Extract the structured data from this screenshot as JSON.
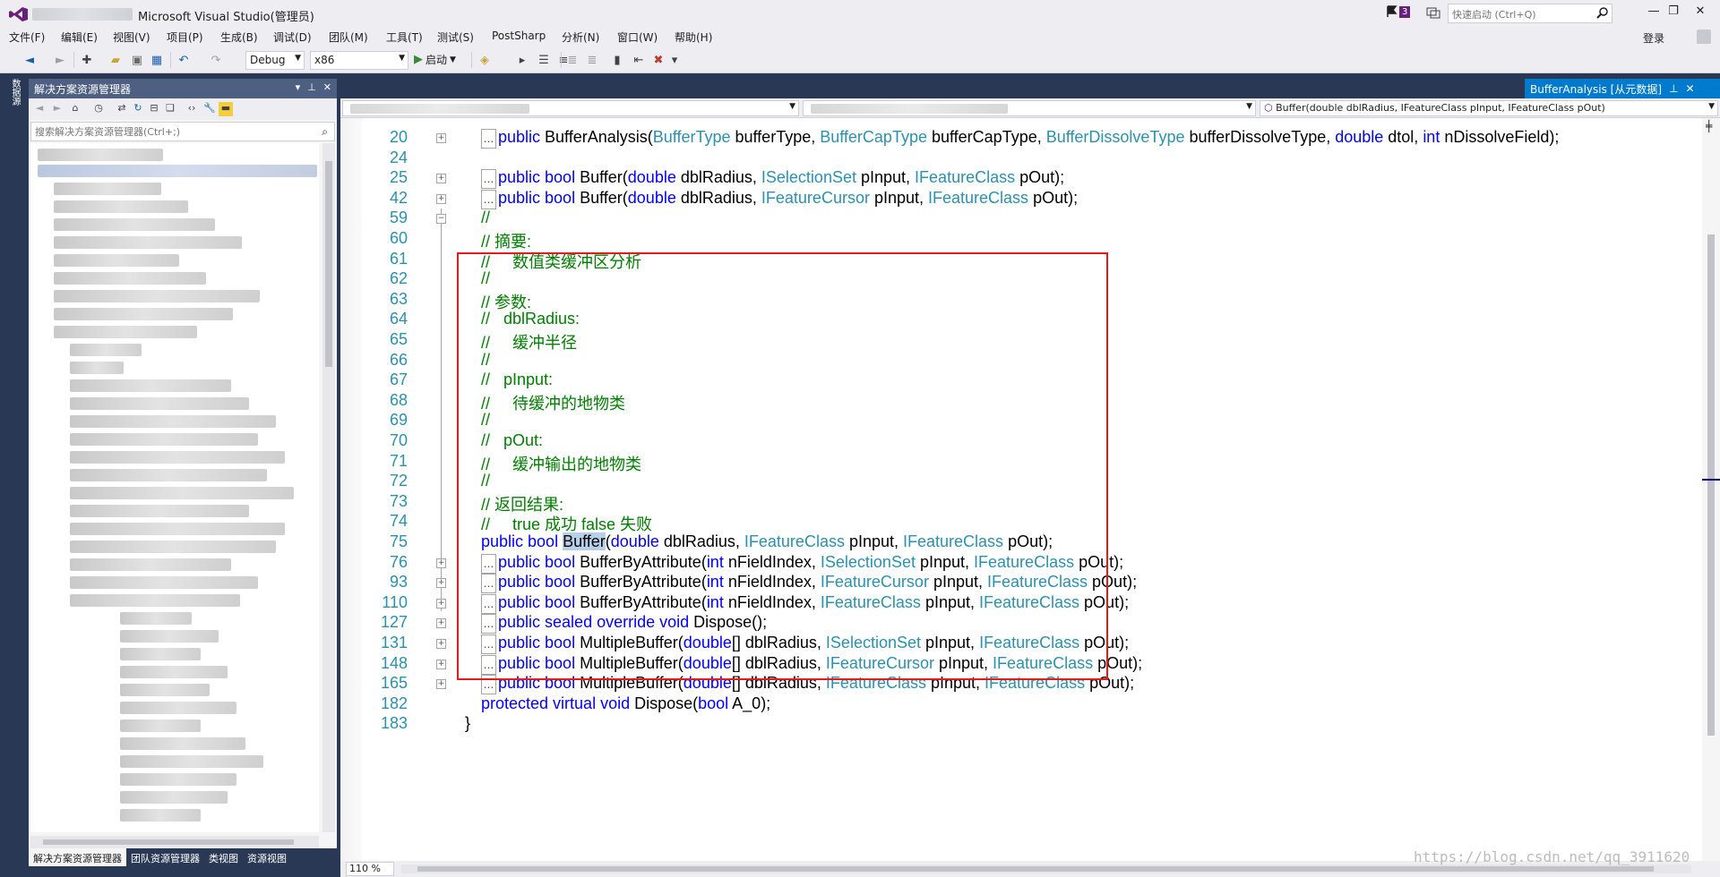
{
  "window": {
    "title": "Microsoft Visual Studio(管理员)",
    "notification_count": "3",
    "quick_launch_placeholder": "快速启动 (Ctrl+Q)"
  },
  "menu": {
    "items": [
      "文件(F)",
      "编辑(E)",
      "视图(V)",
      "项目(P)",
      "生成(B)",
      "调试(D)",
      "团队(M)",
      "工具(T)",
      "测试(S)",
      "PostSharp",
      "分析(N)",
      "窗口(W)",
      "帮助(H)"
    ],
    "login": "登录"
  },
  "toolbar": {
    "configuration": "Debug",
    "platform": "x86",
    "start_label": "启动"
  },
  "left_strip": {
    "tab_label": "数据源"
  },
  "solution_explorer": {
    "title": "解决方案资源管理器",
    "search_placeholder": "搜索解决方案资源管理器(Ctrl+;)",
    "bottom_tabs": [
      "解决方案资源管理器",
      "团队资源管理器",
      "类视图",
      "资源视图"
    ]
  },
  "editor": {
    "tab_title": "BufferAnalysis [从元数据]",
    "nav_member": "Buffer(double dblRadius, IFeatureClass pInput, IFeatureClass pOut)",
    "zoom": "110 %",
    "watermark": "https://blog.csdn.net/qq_3911620",
    "lines": [
      {
        "n": "20",
        "fold": "+",
        "collapsed": true,
        "segs": [
          [
            "kw",
            "public "
          ],
          [
            "",
            "BufferAnalysis("
          ],
          [
            "ty",
            "BufferType"
          ],
          [
            "",
            " bufferType, "
          ],
          [
            "ty",
            "BufferCapType"
          ],
          [
            "",
            " bufferCapType, "
          ],
          [
            "ty",
            "BufferDissolveType"
          ],
          [
            "",
            " bufferDissolveType, "
          ],
          [
            "kw",
            "double"
          ],
          [
            "",
            " dtol, "
          ],
          [
            "kw",
            "int"
          ],
          [
            "",
            " nDissolveField);"
          ]
        ]
      },
      {
        "n": "24",
        "fold": "",
        "collapsed": false,
        "segs": []
      },
      {
        "n": "25",
        "fold": "+",
        "collapsed": true,
        "segs": [
          [
            "kw",
            "public bool "
          ],
          [
            "",
            "Buffer("
          ],
          [
            "kw",
            "double"
          ],
          [
            "",
            " dblRadius, "
          ],
          [
            "ty",
            "ISelectionSet"
          ],
          [
            "",
            " pInput, "
          ],
          [
            "ty",
            "IFeatureClass"
          ],
          [
            "",
            " pOut);"
          ]
        ]
      },
      {
        "n": "42",
        "fold": "+",
        "collapsed": true,
        "segs": [
          [
            "kw",
            "public bool "
          ],
          [
            "",
            "Buffer("
          ],
          [
            "kw",
            "double"
          ],
          [
            "",
            " dblRadius, "
          ],
          [
            "ty",
            "IFeatureCursor"
          ],
          [
            "",
            " pInput, "
          ],
          [
            "ty",
            "IFeatureClass"
          ],
          [
            "",
            " pOut);"
          ]
        ]
      },
      {
        "n": "59",
        "fold": "−",
        "collapsed": false,
        "segs": [
          [
            "cm",
            "//"
          ]
        ]
      },
      {
        "n": "60",
        "fold": "",
        "collapsed": false,
        "segs": [
          [
            "cm",
            "// 摘要:"
          ]
        ]
      },
      {
        "n": "61",
        "fold": "",
        "collapsed": false,
        "segs": [
          [
            "cm",
            "//     数值类缓冲区分析"
          ]
        ]
      },
      {
        "n": "62",
        "fold": "",
        "collapsed": false,
        "segs": [
          [
            "cm",
            "//"
          ]
        ]
      },
      {
        "n": "63",
        "fold": "",
        "collapsed": false,
        "segs": [
          [
            "cm",
            "// 参数:"
          ]
        ]
      },
      {
        "n": "64",
        "fold": "",
        "collapsed": false,
        "segs": [
          [
            "cm",
            "//   dblRadius:"
          ]
        ]
      },
      {
        "n": "65",
        "fold": "",
        "collapsed": false,
        "segs": [
          [
            "cm",
            "//     缓冲半径"
          ]
        ]
      },
      {
        "n": "66",
        "fold": "",
        "collapsed": false,
        "segs": [
          [
            "cm",
            "//"
          ]
        ]
      },
      {
        "n": "67",
        "fold": "",
        "collapsed": false,
        "segs": [
          [
            "cm",
            "//   pInput:"
          ]
        ]
      },
      {
        "n": "68",
        "fold": "",
        "collapsed": false,
        "segs": [
          [
            "cm",
            "//     待缓冲的地物类"
          ]
        ]
      },
      {
        "n": "69",
        "fold": "",
        "collapsed": false,
        "segs": [
          [
            "cm",
            "//"
          ]
        ]
      },
      {
        "n": "70",
        "fold": "",
        "collapsed": false,
        "segs": [
          [
            "cm",
            "//   pOut:"
          ]
        ]
      },
      {
        "n": "71",
        "fold": "",
        "collapsed": false,
        "segs": [
          [
            "cm",
            "//     缓冲输出的地物类"
          ]
        ]
      },
      {
        "n": "72",
        "fold": "",
        "collapsed": false,
        "segs": [
          [
            "cm",
            "//"
          ]
        ]
      },
      {
        "n": "73",
        "fold": "",
        "collapsed": false,
        "segs": [
          [
            "cm",
            "// 返回结果:"
          ]
        ]
      },
      {
        "n": "74",
        "fold": "",
        "collapsed": false,
        "segs": [
          [
            "cm",
            "//     true 成功 false 失败"
          ]
        ]
      },
      {
        "n": "75",
        "fold": "",
        "collapsed": false,
        "segs": [
          [
            "kw",
            "public bool "
          ],
          [
            "hl",
            "Buffer"
          ],
          [
            "",
            "("
          ],
          [
            "kw",
            "double"
          ],
          [
            "",
            " dblRadius, "
          ],
          [
            "ty",
            "IFeatureClass"
          ],
          [
            "",
            " pInput, "
          ],
          [
            "ty",
            "IFeatureClass"
          ],
          [
            "",
            " pOut);"
          ]
        ]
      },
      {
        "n": "76",
        "fold": "+",
        "collapsed": true,
        "segs": [
          [
            "kw",
            "public bool "
          ],
          [
            "",
            "BufferByAttribute("
          ],
          [
            "kw",
            "int"
          ],
          [
            "",
            " nFieldIndex, "
          ],
          [
            "ty",
            "ISelectionSet"
          ],
          [
            "",
            " pInput, "
          ],
          [
            "ty",
            "IFeatureClass"
          ],
          [
            "",
            " pOut);"
          ]
        ]
      },
      {
        "n": "93",
        "fold": "+",
        "collapsed": true,
        "segs": [
          [
            "kw",
            "public bool "
          ],
          [
            "",
            "BufferByAttribute("
          ],
          [
            "kw",
            "int"
          ],
          [
            "",
            " nFieldIndex, "
          ],
          [
            "ty",
            "IFeatureCursor"
          ],
          [
            "",
            " pInput, "
          ],
          [
            "ty",
            "IFeatureClass"
          ],
          [
            "",
            " pOut);"
          ]
        ]
      },
      {
        "n": "110",
        "fold": "+",
        "collapsed": true,
        "segs": [
          [
            "kw",
            "public bool "
          ],
          [
            "",
            "BufferByAttribute("
          ],
          [
            "kw",
            "int"
          ],
          [
            "",
            " nFieldIndex, "
          ],
          [
            "ty",
            "IFeatureClass"
          ],
          [
            "",
            " pInput, "
          ],
          [
            "ty",
            "IFeatureClass"
          ],
          [
            "",
            " pOut);"
          ]
        ]
      },
      {
        "n": "127",
        "fold": "+",
        "collapsed": true,
        "segs": [
          [
            "kw",
            "public sealed override void "
          ],
          [
            "",
            "Dispose();"
          ]
        ]
      },
      {
        "n": "131",
        "fold": "+",
        "collapsed": true,
        "segs": [
          [
            "kw",
            "public bool "
          ],
          [
            "",
            "MultipleBuffer("
          ],
          [
            "kw",
            "double"
          ],
          [
            "",
            "[] dblRadius, "
          ],
          [
            "ty",
            "ISelectionSet"
          ],
          [
            "",
            " pInput, "
          ],
          [
            "ty",
            "IFeatureClass"
          ],
          [
            "",
            " pOut);"
          ]
        ]
      },
      {
        "n": "148",
        "fold": "+",
        "collapsed": true,
        "segs": [
          [
            "kw",
            "public bool "
          ],
          [
            "",
            "MultipleBuffer("
          ],
          [
            "kw",
            "double"
          ],
          [
            "",
            "[] dblRadius, "
          ],
          [
            "ty",
            "IFeatureCursor"
          ],
          [
            "",
            " pInput, "
          ],
          [
            "ty",
            "IFeatureClass"
          ],
          [
            "",
            " pOut);"
          ]
        ]
      },
      {
        "n": "165",
        "fold": "+",
        "collapsed": true,
        "segs": [
          [
            "kw",
            "public bool "
          ],
          [
            "",
            "MultipleBuffer("
          ],
          [
            "kw",
            "double"
          ],
          [
            "",
            "[] dblRadius, "
          ],
          [
            "ty",
            "IFeatureClass"
          ],
          [
            "",
            " pInput, "
          ],
          [
            "ty",
            "IFeatureClass"
          ],
          [
            "",
            " pOut);"
          ]
        ]
      },
      {
        "n": "182",
        "fold": "",
        "collapsed": false,
        "segs": [
          [
            "kw",
            "protected virtual void "
          ],
          [
            "",
            "Dispose("
          ],
          [
            "kw",
            "bool"
          ],
          [
            "",
            " A_0);"
          ]
        ]
      },
      {
        "n": "183",
        "fold": "",
        "collapsed": false,
        "outer": true,
        "segs": [
          [
            "",
            "}"
          ]
        ]
      }
    ]
  }
}
